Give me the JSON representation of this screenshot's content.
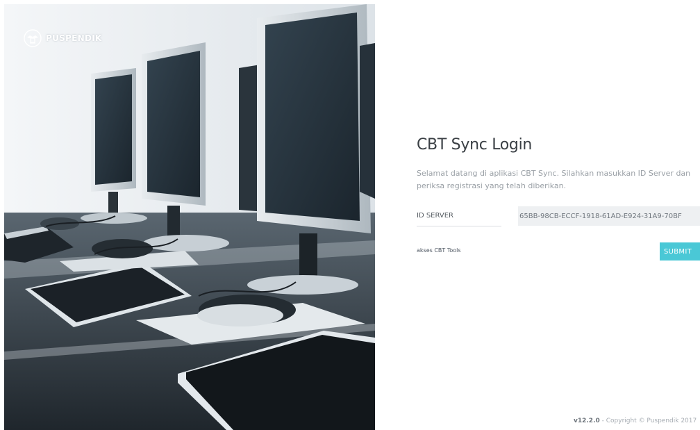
{
  "brand": {
    "name": "PUSPENDIK",
    "logo_icon": "garuda-emblem-icon"
  },
  "photo": {
    "subject": "computer-lab-photo"
  },
  "login": {
    "title": "CBT Sync Login",
    "description": "Selamat datang di aplikasi CBT Sync. Silahkan masukkan ID Server dan periksa registrasi yang telah diberikan.",
    "id_server_label": "ID SERVER",
    "id_server_value": "65BB-98CB-ECCF-1918-61AD-E924-31A9-70BF",
    "tools_link": "akses CBT Tools",
    "submit_label": "SUBMIT"
  },
  "footer": {
    "version": "v12.2.0",
    "copyright": " - Copyright © Puspendik 2017"
  },
  "colors": {
    "accent": "#4ac8d6",
    "title": "#3a3f44",
    "muted": "#9aa0a6",
    "input_bg": "#eef0f2"
  }
}
